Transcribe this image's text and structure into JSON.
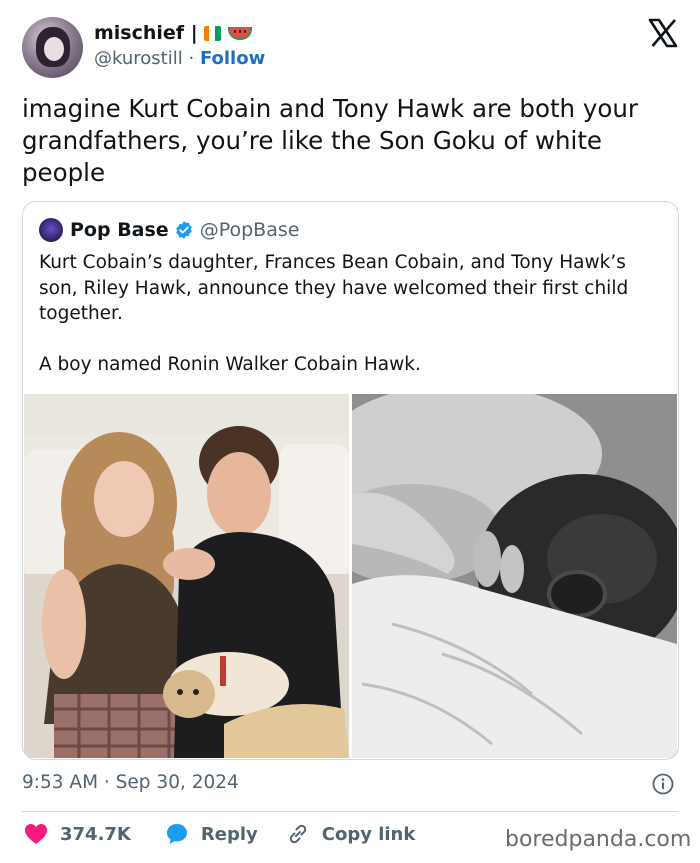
{
  "author": {
    "name": "mischief |",
    "handle": "@kurostill",
    "separator": "·",
    "follow_label": "Follow"
  },
  "tweet_text": "imagine Kurt Cobain and Tony Hawk are both your grandfathers, you’re like the Son Goku of white people",
  "quoted": {
    "name": "Pop Base",
    "handle": "@PopBase",
    "paragraph1": "Kurt Cobain’s daughter, Frances Bean Cobain, and Tony Hawk’s son, Riley Hawk, announce they have welcomed their first child together.",
    "paragraph2": "A boy named Ronin Walker Cobain Hawk."
  },
  "timestamp": "9:53 AM · Sep 30, 2024",
  "actions": {
    "likes": "374.7K",
    "reply_label": "Reply",
    "copy_link_label": "Copy link"
  },
  "watermark": "boredpanda.com",
  "colors": {
    "like": "#f91880",
    "reply": "#1d9bf0",
    "follow": "#1d6fc2",
    "verified": "#1d9bf0"
  },
  "icons": [
    "x-logo-icon",
    "ivory-coast-flag-icon",
    "watermelon-icon",
    "verified-badge-icon",
    "info-icon",
    "heart-icon",
    "reply-bubble-icon",
    "link-icon"
  ]
}
